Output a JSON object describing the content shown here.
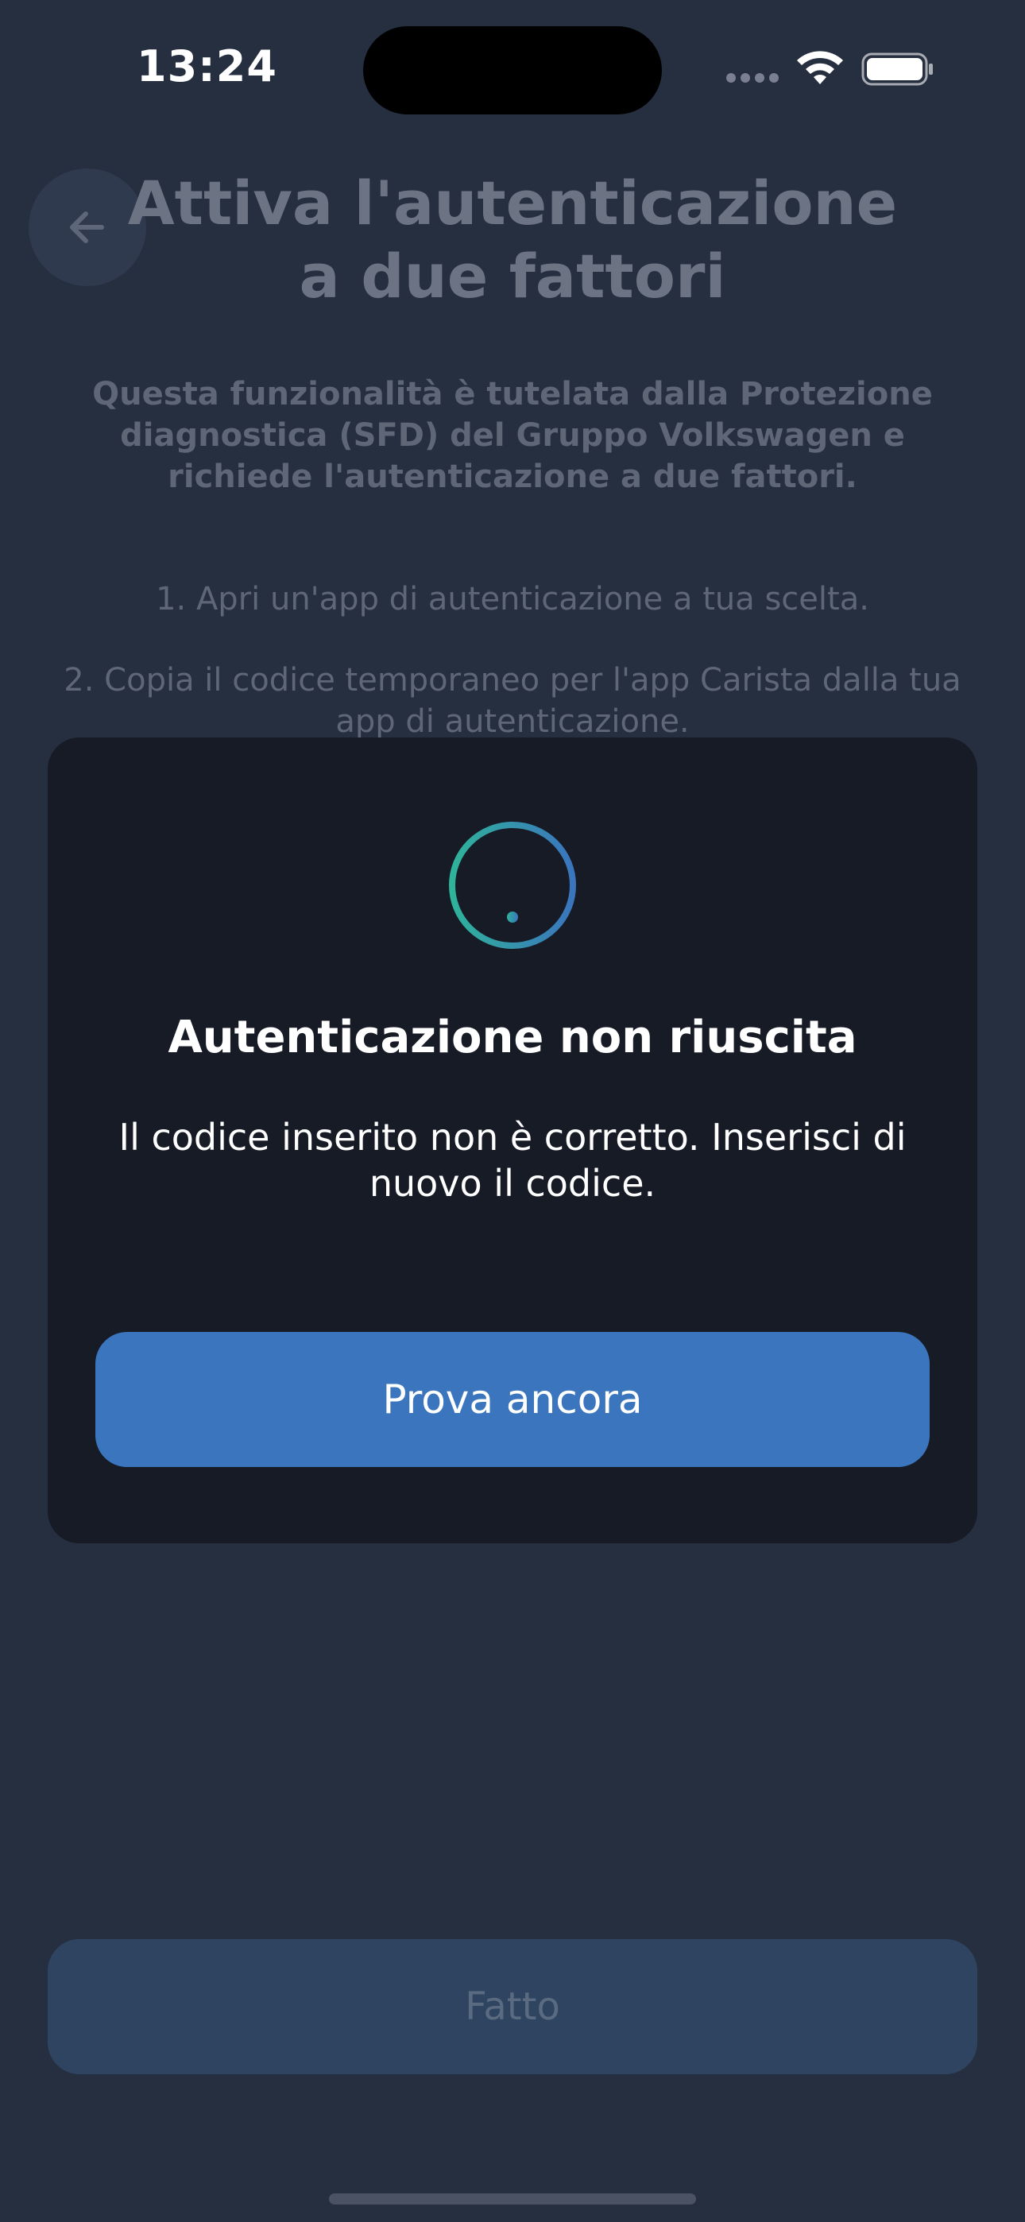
{
  "status_bar": {
    "time": "13:24"
  },
  "header": {
    "title_line1": "Attiva l'autenticazione",
    "title_line2": "a due fattori"
  },
  "intro": {
    "text": "Questa funzionalità è tutelata dalla Protezione diagnostica (SFD) del Gruppo Volkswagen e richiede l'autenticazione a due fattori."
  },
  "steps": [
    "1. Apri un'app di autenticazione a tua scelta.",
    "2. Copia il codice temporaneo per l'app Carista dalla tua app di autenticazione."
  ],
  "footer": {
    "done_label": "Fatto"
  },
  "modal": {
    "icon": "exclamation-circle-icon",
    "title": "Autenticazione non riuscita",
    "message": "Il codice inserito non è corretto. Inserisci di nuovo il codice.",
    "retry_label": "Prova ancora"
  },
  "colors": {
    "background": "#262f40",
    "modal_background": "#171b26",
    "primary_button": "#3a75bd",
    "disabled_button": "#2e4461",
    "icon_gradient_start": "#2fb39a",
    "icon_gradient_end": "#3a75bd"
  }
}
